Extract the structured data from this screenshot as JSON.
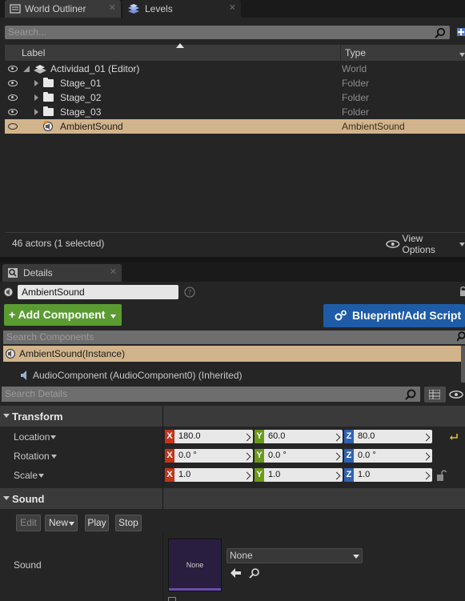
{
  "tabs": {
    "world_outliner": "World Outliner",
    "levels": "Levels",
    "details": "Details"
  },
  "outliner": {
    "search_placeholder": "Search...",
    "col_label": "Label",
    "col_type": "Type",
    "rows": [
      {
        "label": "Actividad_01 (Editor)",
        "type": "World"
      },
      {
        "label": "Stage_01",
        "type": "Folder"
      },
      {
        "label": "Stage_02",
        "type": "Folder"
      },
      {
        "label": "Stage_03",
        "type": "Folder"
      },
      {
        "label": "AmbientSound",
        "type": "AmbientSound"
      }
    ],
    "actor_count": "46 actors (1 selected)",
    "view_options": "View Options"
  },
  "details": {
    "actor_name": "AmbientSound",
    "add_component": "Add Component",
    "blueprint_button": "Blueprint/Add Script",
    "search_components_placeholder": "Search Components",
    "component_instance": "AmbientSound(Instance)",
    "component_child": "AudioComponent (AudioComponent0) (Inherited)",
    "search_details_placeholder": "Search Details",
    "transform": {
      "title": "Transform",
      "location_label": "Location",
      "rotation_label": "Rotation",
      "scale_label": "Scale",
      "location": {
        "x": "180.0",
        "y": "60.0",
        "z": "80.0"
      },
      "rotation": {
        "x": "0.0 °",
        "y": "0.0 °",
        "z": "0.0 °"
      },
      "scale": {
        "x": "1.0",
        "y": "1.0",
        "z": "1.0"
      }
    },
    "sound": {
      "title": "Sound",
      "edit": "Edit",
      "new": "New",
      "play": "Play",
      "stop": "Stop",
      "label": "Sound",
      "thumb_text": "None",
      "combo_value": "None"
    }
  },
  "axes": {
    "x": "X",
    "y": "Y",
    "z": "Z"
  },
  "colors": {
    "selection": "#d2b48c",
    "add_component_green": "#5a9c32",
    "blueprint_blue": "#1e5ca8",
    "axis_x": "#c4331a",
    "axis_y": "#6a9a1a",
    "axis_z": "#2d63b5"
  }
}
